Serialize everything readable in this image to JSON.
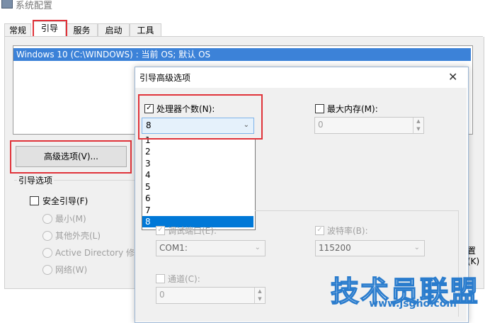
{
  "window": {
    "title": "系统配置"
  },
  "tabs": [
    {
      "label": "常规"
    },
    {
      "label": "引导"
    },
    {
      "label": "服务"
    },
    {
      "label": "启动"
    },
    {
      "label": "工具"
    }
  ],
  "os_list": {
    "selected": "Windows 10 (C:\\WINDOWS) : 当前 OS; 默认 OS"
  },
  "advanced_button": "高级选项(V)...",
  "boot_options": {
    "label": "引导选项",
    "safe_boot": "安全引导(F)",
    "radios": [
      "最小(M)",
      "其他外壳(L)",
      "Active Directory 修",
      "网络(W)"
    ]
  },
  "partial_right_text": "置(K)",
  "dialog": {
    "title": "引导高级选项",
    "processors": {
      "label": "处理器个数(N):",
      "checked": true,
      "value": "8",
      "options": [
        "1",
        "2",
        "3",
        "4",
        "5",
        "6",
        "7",
        "8"
      ],
      "selected_index": 7
    },
    "max_memory": {
      "label": "最大内存(M):",
      "checked": false,
      "value": "0"
    },
    "debug_port": {
      "label": "调试端口(E):",
      "value": "COM1:"
    },
    "baud_rate": {
      "label": "波特率(B):",
      "value": "115200"
    },
    "channel": {
      "label": "通道(C):",
      "value": "0"
    }
  },
  "watermark": {
    "text": "技术员联盟",
    "url": "www.jsgho.com"
  }
}
